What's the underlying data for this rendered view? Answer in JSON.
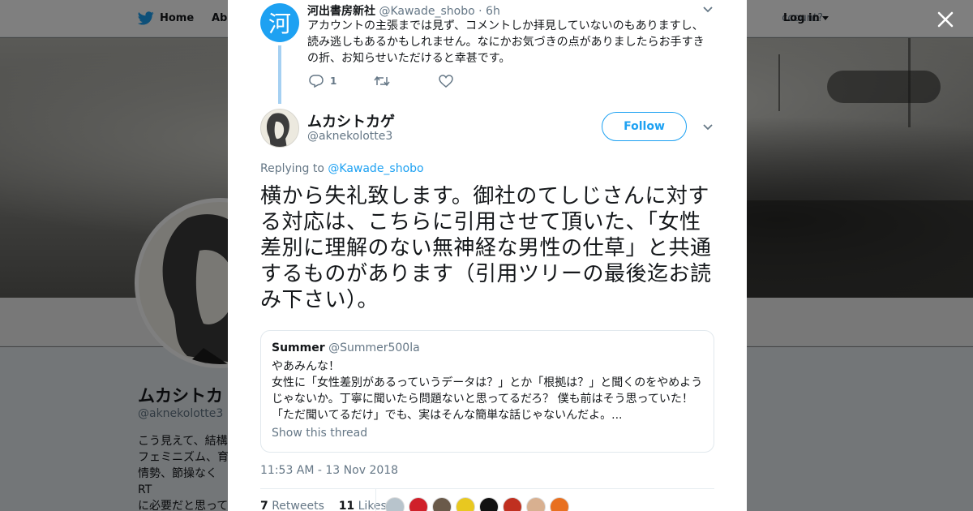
{
  "nav": {
    "home_label": "Home",
    "about_label": "Abo",
    "account_prompt": "ccount?",
    "login_label": "Log in"
  },
  "background_profile": {
    "name": "ムカシトカ",
    "handle": "@aknekolotte3",
    "bio_lines": [
      "こう見えて、結構",
      "フェミニズム、育",
      "情勢、節操なくRT",
      "に必要だと思って"
    ]
  },
  "parent_tweet": {
    "avatar_glyph": "河",
    "name": "河出書房新社",
    "handle": "@Kawade_shobo",
    "time": "· 6h",
    "text": "アカウントの主張までは見ず、コメントしか拝見していないのもありますし、読み逃しもあるかもしれません。なにかお気づきの点がありましたらお手すきの折、お知らせいただけると幸甚です。",
    "reply_count": "1",
    "retweet_count": "",
    "like_count": ""
  },
  "tweet": {
    "author_name": "ムカシトカゲ",
    "author_handle": "@aknekolotte3",
    "follow_label": "Follow",
    "replying_prefix": "Replying to",
    "replying_to": "@Kawade_shobo",
    "text": "横から失礼致します。御社のてしじさんに対する対応は、こちらに引用させて頂いた、「女性差別に理解のない無神経な男性の仕草」と共通するものがあります（引用ツリーの最後迄お読み下さい）。",
    "timestamp": "11:53 AM - 13 Nov 2018",
    "retweets_count": "7",
    "retweets_label": "Retweets",
    "likes_count": "11",
    "likes_label": "Likes"
  },
  "quoted_tweet": {
    "name": "Summer",
    "handle": "@Summer500la",
    "text_line1": "やあみんな！",
    "text_rest": "女性に「女性差別があるっていうデータは？」とか「根拠は？」と聞くのをやめようじゃないか。丁寧に聞いたら問題ないと思ってるだろ？ 僕も前はそう思っていた！「ただ聞いてるだけ」でも、実はそんな簡単な話じゃないんだよ。...",
    "show_thread_label": "Show this thread"
  },
  "colors": {
    "accent": "#1da1f2",
    "text": "#14171a",
    "muted": "#657786",
    "liker_avatars": [
      "#b8c4cc",
      "#d0202a",
      "#6a5a4a",
      "#e8c820",
      "#111111",
      "#c03020",
      "#d8b090",
      "#e87020"
    ]
  },
  "icons": [
    "twitter-bird-icon",
    "close-icon",
    "reply-icon",
    "retweet-icon",
    "like-icon",
    "chevron-down-icon"
  ]
}
